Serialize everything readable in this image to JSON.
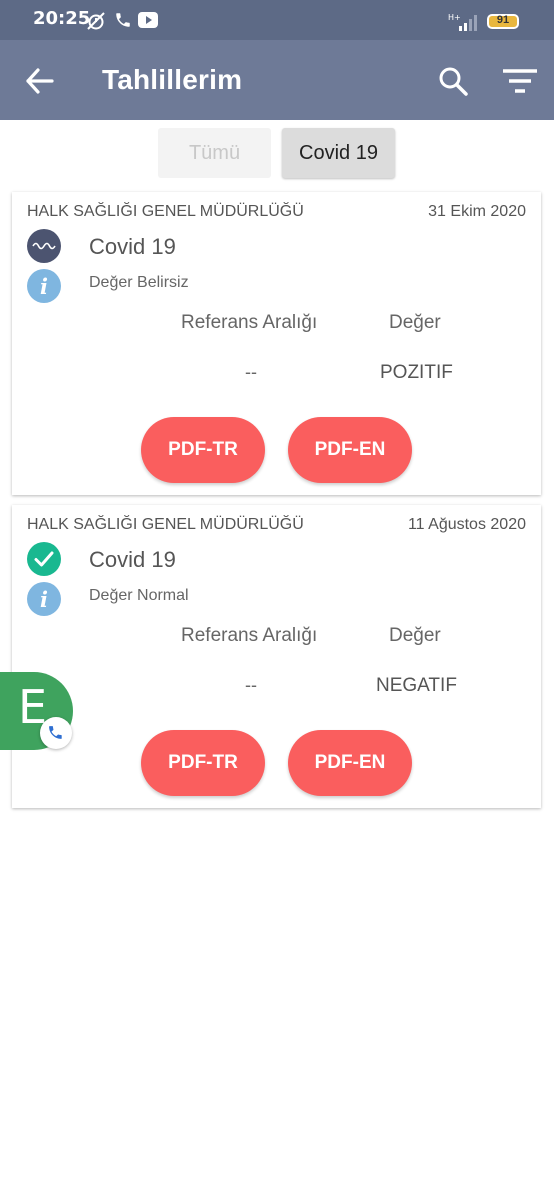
{
  "status_bar": {
    "time": "20:25",
    "battery": "91",
    "icons": [
      "alarm-off-icon",
      "phone-icon",
      "youtube-icon",
      "signal-icon",
      "battery-icon"
    ]
  },
  "app_bar": {
    "title": "Tahlillerim",
    "icons": [
      "back-arrow-icon",
      "search-icon",
      "filter-icon"
    ],
    "background": "#6e7a97"
  },
  "filters": {
    "all_label": "Tümü",
    "covid_label": "Covid 19",
    "selected": "Covid 19"
  },
  "results": [
    {
      "organization": "HALK SAĞLIĞI GENEL MÜDÜRLÜĞÜ",
      "date": "31 Ekim 2020",
      "test_name": "Covid 19",
      "status_icon": "wave-icon",
      "value_status": "Değer Belirsiz",
      "ref_header": "Referans Aralığı",
      "value_header": "Değer",
      "ref_value": "--",
      "result": "POZITIF",
      "pdf_tr_label": "PDF-TR",
      "pdf_en_label": "PDF-EN"
    },
    {
      "organization": "HALK SAĞLIĞI GENEL MÜDÜRLÜĞÜ",
      "date": "11 Ağustos 2020",
      "test_name": "Covid 19",
      "status_icon": "check-icon",
      "value_status": "Değer Normal",
      "ref_header": "Referans Aralığı",
      "value_header": "Değer",
      "ref_value": "--",
      "result": "NEGATIF",
      "pdf_tr_label": "PDF-TR",
      "pdf_en_label": "PDF-EN"
    }
  ],
  "floating_contact": {
    "letter": "E",
    "icon": "phone-icon"
  },
  "colors": {
    "accent_button": "#fa5e5e",
    "status_uncertain": "#4c5470",
    "status_normal": "#19b890",
    "info": "#7fb6e0"
  }
}
